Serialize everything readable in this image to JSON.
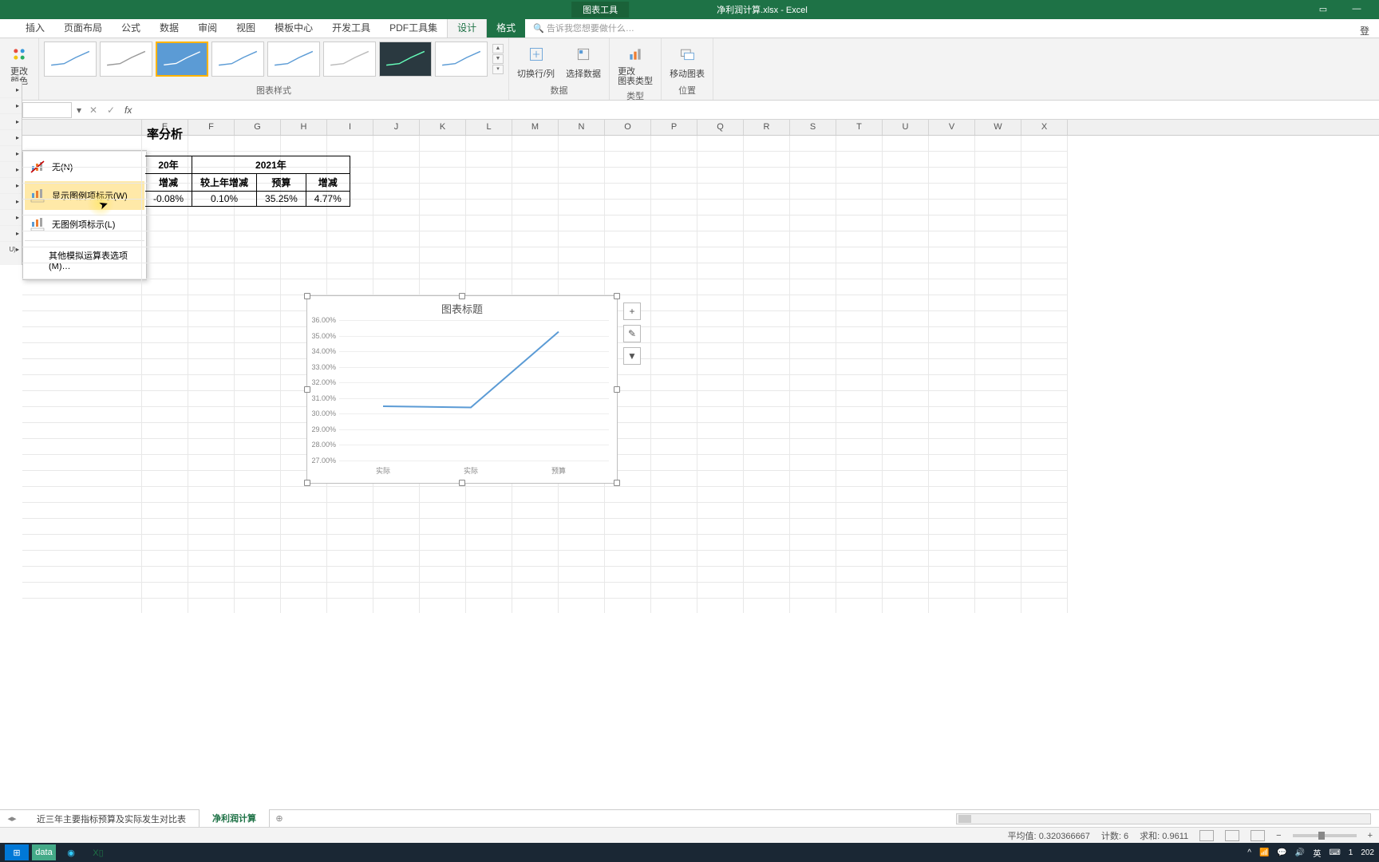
{
  "title": {
    "chart_tools": "图表工具",
    "doc": "净利润计算.xlsx - Excel"
  },
  "tabs": {
    "insert": "插入",
    "page_layout": "页面布局",
    "formulas": "公式",
    "data": "数据",
    "review": "审阅",
    "view": "视图",
    "template": "模板中心",
    "dev": "开发工具",
    "pdf": "PDF工具集",
    "design": "设计",
    "format": "格式",
    "tell_me": "告诉我您想要做什么…",
    "login": "登"
  },
  "ribbon": {
    "change_colors": "更改\n颜色",
    "switch": "切换行/列",
    "select_data": "选择数据",
    "change_type": "更改\n图表类型",
    "move": "移动图表",
    "g_styles": "图表样式",
    "g_data": "数据",
    "g_type": "类型",
    "g_pos": "位置"
  },
  "dd": {
    "none": "无(N)",
    "show_legend": "显示图例项标示(W)",
    "no_legend": "无图例项标示(L)",
    "more": "其他模拟运算表选项(M)…"
  },
  "table": {
    "title_frag": "率分析",
    "y20": "20年",
    "y21": "2021年",
    "h_change": "增减",
    "h_yoy": "较上年增减",
    "h_budget": "预算",
    "r1": {
      "c1": "-0.08%",
      "c2": "0.10%",
      "c3": "35.25%",
      "c4": "4.77%"
    }
  },
  "chart_data": {
    "type": "line",
    "title": "图表标题",
    "ylabel": "",
    "xlabel": "",
    "ylim": [
      27,
      36
    ],
    "y_ticks": [
      "36.00%",
      "35.00%",
      "34.00%",
      "33.00%",
      "32.00%",
      "31.00%",
      "30.00%",
      "29.00%",
      "28.00%",
      "27.00%"
    ],
    "categories": [
      "实际",
      "实际",
      "预算"
    ],
    "values": [
      30.48,
      30.4,
      35.25
    ]
  },
  "chart_side": {
    "plus": "+",
    "brush": "✎",
    "filter": "▼"
  },
  "sheets": {
    "s1": "近三年主要指标预算及实际发生对比表",
    "s2": "净利润计算"
  },
  "status": {
    "avg_label": "平均值:",
    "avg": "0.320366667",
    "cnt_label": "计数:",
    "cnt": "6",
    "sum_label": "求和:",
    "sum": "0.9611"
  },
  "taskbar": {
    "ime": "英",
    "time": "1",
    "date": "202"
  },
  "cols": [
    "",
    "E",
    "F",
    "G",
    "H",
    "I",
    "J",
    "K",
    "L",
    "M",
    "N",
    "O",
    "P",
    "Q",
    "R",
    "S",
    "T",
    "U",
    "V",
    "W",
    "X"
  ]
}
